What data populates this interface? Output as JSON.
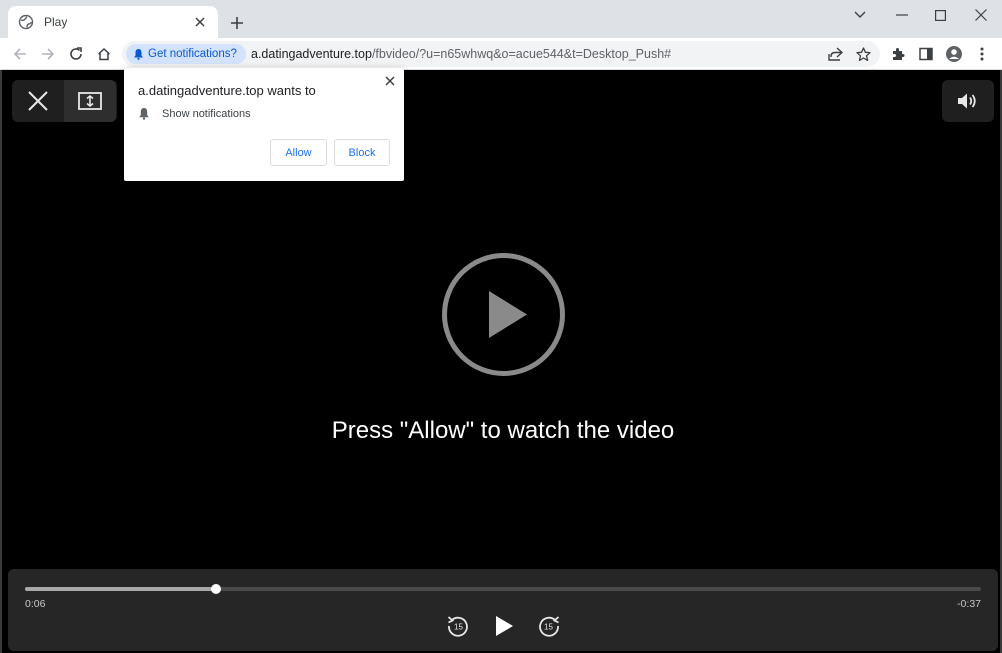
{
  "tab": {
    "title": "Play",
    "favicon": "globe-icon"
  },
  "toolbar": {
    "notification_chip": "Get notifications?",
    "url_host": "a.datingadventure.top",
    "url_path": "/fbvideo/?u=n65whwq&o=acue544&t=Desktop_Push#"
  },
  "popup": {
    "title": "a.datingadventure.top wants to",
    "permission": "Show notifications",
    "allow_label": "Allow",
    "block_label": "Block"
  },
  "player": {
    "message": "Press \"Allow\" to watch the video",
    "elapsed": "0:06",
    "remaining": "-0:37",
    "progress": 0.2,
    "skip_back_seconds": "15",
    "skip_forward_seconds": "15"
  },
  "colors": {
    "accent": "#1a73e8",
    "chip_bg": "#d3e3fd",
    "page_bg": "#000000",
    "controls_bg": "#262626"
  }
}
